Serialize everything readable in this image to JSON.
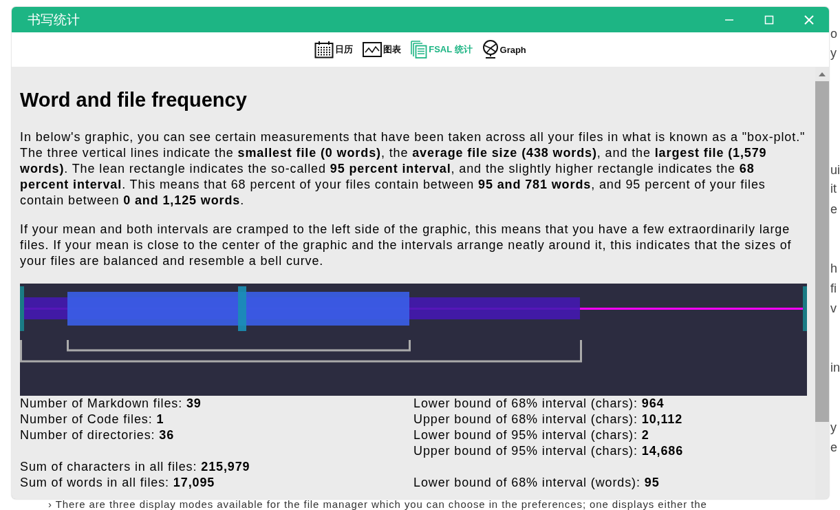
{
  "background_page": {
    "edge_fragments": [
      "o",
      "y",
      "ui",
      "it",
      "e",
      "h",
      "fi",
      "v",
      "in",
      "y",
      "e"
    ],
    "bottom_line": "› There are three display modes available for the file manager which you can choose in the preferences; one displays either the"
  },
  "window": {
    "title": "书写统计"
  },
  "toolbar": [
    {
      "kind": "calendar",
      "label": "日历",
      "selected": false
    },
    {
      "kind": "chart",
      "label": "图表",
      "selected": false
    },
    {
      "kind": "files",
      "label": "FSAL 统计",
      "selected": true
    },
    {
      "kind": "graph",
      "label": "Graph",
      "selected": false
    }
  ],
  "heading": "Word and file frequency",
  "paragraphs": [
    "In below's graphic, you can see certain measurements that have been taken across all your files in what is known as a \"box-plot.\" The three vertical lines indicate the **smallest file (0 words)**, the **average file size (438 words)**, and the **largest file (1,579 words)**. The lean rectangle indicates the so-called **95 percent interval**, and the slightly higher rectangle indicates the **68 percent interval**. This means that 68 percent of your files contain between **95 and 781 words**, and 95 percent of your files contain between **0 and 1,125 words**.",
    "If your mean and both intervals are cramped to the left side of the graphic, this means that you have a few extraordinarily large files. If your mean is close to the center of the graphic and the intervals arrange neatly around it, this indicates that the sizes of your files are balanced and resemble a bell curve."
  ],
  "stats": [
    {
      "left": {
        "label": "Number of Markdown files:",
        "value": "39"
      },
      "right": {
        "label": "Lower bound of 68% interval (chars):",
        "value": "964"
      }
    },
    {
      "left": {
        "label": "Number of Code files:",
        "value": "1"
      },
      "right": {
        "label": "Upper bound of 68% interval (chars):",
        "value": "10,112"
      }
    },
    {
      "left": {
        "label": "Number of directories:",
        "value": "36"
      },
      "right": {
        "label": "Lower bound of 95% interval (chars):",
        "value": "2"
      }
    },
    {
      "right": {
        "label": "Upper bound of 95% interval (chars):",
        "value": "14,686"
      }
    },
    {
      "left": {
        "label": "Sum of characters in all files:",
        "value": "215,979"
      }
    },
    {
      "left": {
        "label": "Sum of words in all files:",
        "value": "17,095"
      },
      "right": {
        "label": "Lower bound of 68% interval (words):",
        "value": "95"
      }
    }
  ]
}
